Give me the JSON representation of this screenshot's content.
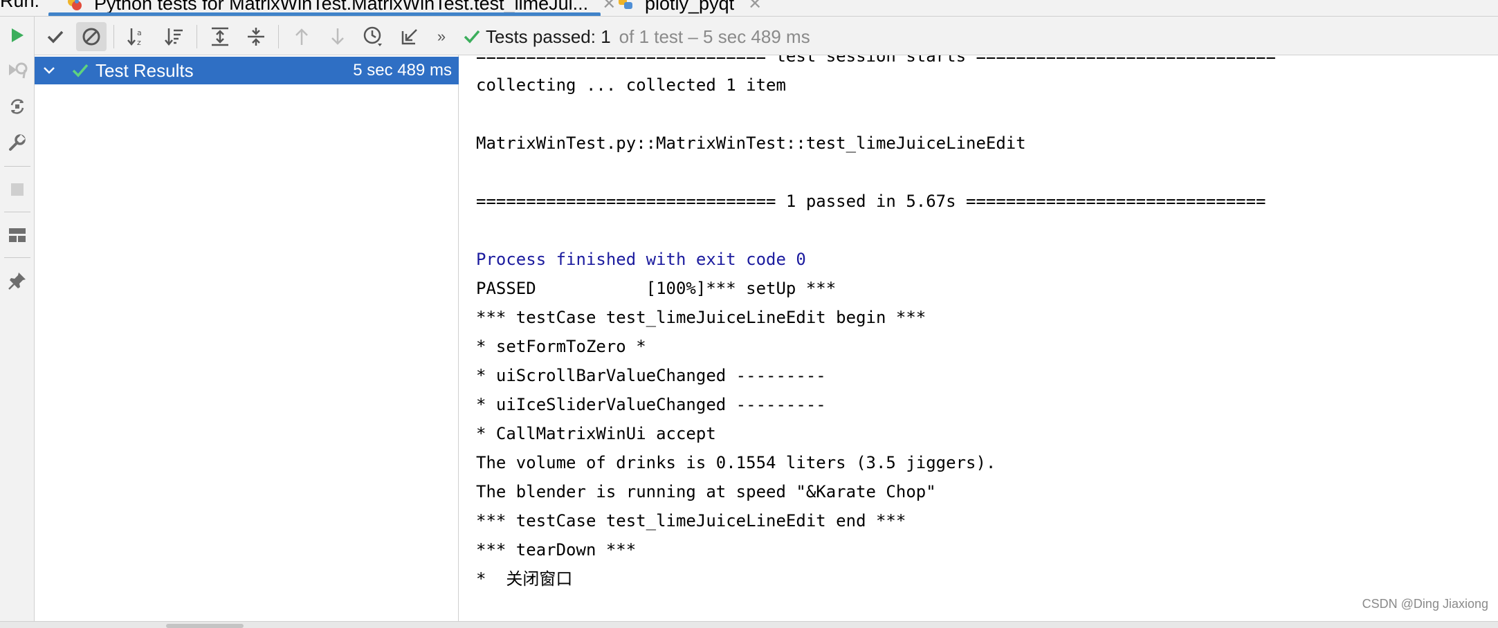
{
  "tabs": {
    "run_label": "Run:",
    "items": [
      {
        "label": "Python tests for MatrixWinTest.MatrixWinTest.test_limeJui...",
        "active": true
      },
      {
        "label": "plotly_pyqt",
        "active": false
      }
    ]
  },
  "left_toolbar": {
    "buttons": [
      "run-icon",
      "rerun-failed-icon",
      "toggle-auto-test-icon",
      "settings-wrench-icon",
      "stop-icon",
      "layout-icon",
      "pin-icon"
    ]
  },
  "toolbar": {
    "buttons": [
      "show-passed-icon",
      "show-ignored-icon",
      "sort-alphabetically-icon",
      "sort-by-duration-icon",
      "expand-all-icon",
      "collapse-all-icon",
      "previous-test-icon",
      "next-test-icon",
      "test-history-icon",
      "import-tests-icon",
      "more-chevron-icon"
    ],
    "status_passed": "Tests passed: 1",
    "status_of": "of 1 test – 5 sec 489 ms"
  },
  "tree": {
    "root_label": "Test Results",
    "root_time": "5 sec 489 ms"
  },
  "console": {
    "lines": [
      {
        "text": "============================= test session starts ==============================",
        "style": "normal"
      },
      {
        "text": "collecting ... collected 1 item",
        "style": "normal"
      },
      {
        "text": "",
        "style": "normal"
      },
      {
        "text": "MatrixWinTest.py::MatrixWinTest::test_limeJuiceLineEdit",
        "style": "normal"
      },
      {
        "text": "",
        "style": "normal"
      },
      {
        "text": "============================== 1 passed in 5.67s ==============================",
        "style": "normal"
      },
      {
        "text": "",
        "style": "normal"
      },
      {
        "text": "Process finished with exit code 0",
        "style": "blue"
      },
      {
        "text": "PASSED           [100%]*** setUp ***",
        "style": "normal"
      },
      {
        "text": "*** testCase test_limeJuiceLineEdit begin ***",
        "style": "normal"
      },
      {
        "text": "* setFormToZero *",
        "style": "normal"
      },
      {
        "text": "* uiScrollBarValueChanged ---------",
        "style": "normal"
      },
      {
        "text": "* uiIceSliderValueChanged ---------",
        "style": "normal"
      },
      {
        "text": "* CallMatrixWinUi accept",
        "style": "normal"
      },
      {
        "text": "The volume of drinks is 0.1554 liters (3.5 jiggers).",
        "style": "normal"
      },
      {
        "text": "The blender is running at speed \"&Karate Chop\"",
        "style": "normal"
      },
      {
        "text": "*** testCase test_limeJuiceLineEdit end ***",
        "style": "normal"
      },
      {
        "text": "*** tearDown ***",
        "style": "normal"
      },
      {
        "text": "*  关闭窗口",
        "style": "normal"
      }
    ]
  },
  "watermark": "CSDN @Ding Jiaxiong",
  "colors": {
    "selection": "#2f6fc4",
    "passed_green": "#3cae5c",
    "run_green": "#3cae5c",
    "exit_code_blue": "#1b1b9e"
  }
}
